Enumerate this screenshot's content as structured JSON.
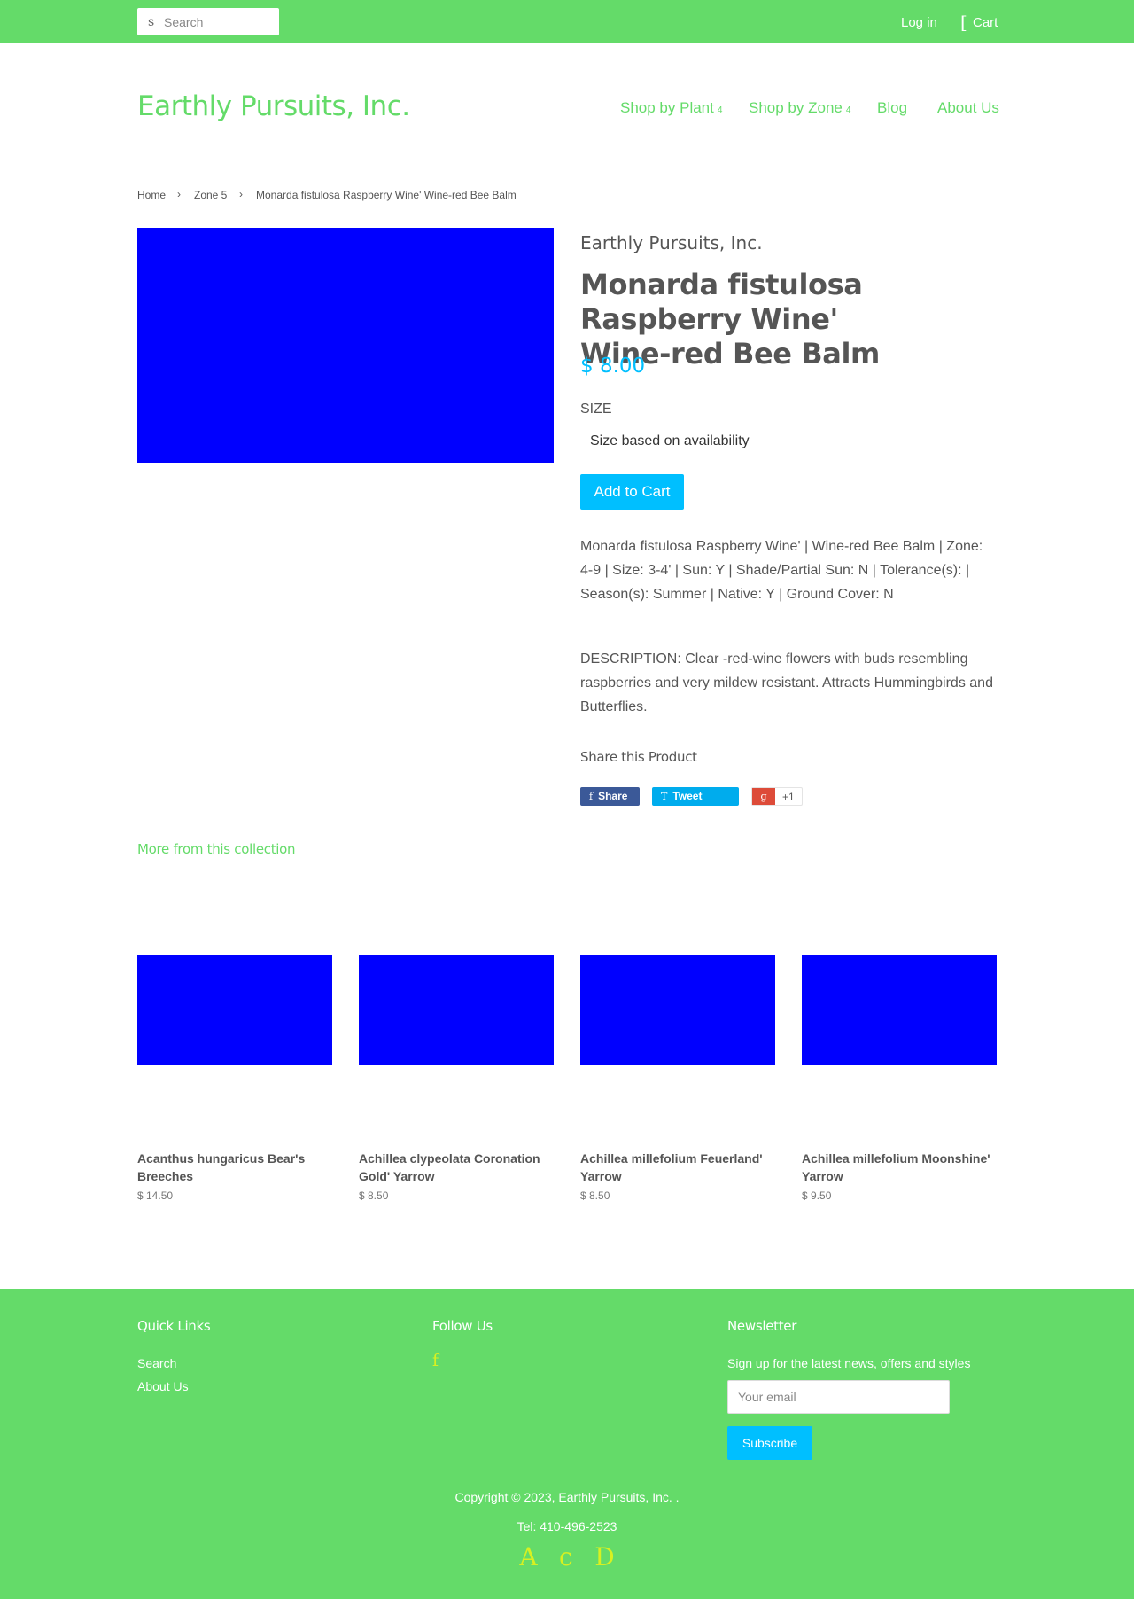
{
  "topbar": {
    "search_icon": "s",
    "search_placeholder": "Search",
    "login_label": "Log in",
    "cart_icon": "[",
    "cart_label": "Cart"
  },
  "header": {
    "site_title": "Earthly Pursuits, Inc.",
    "nav": [
      {
        "label": "Shop by Plant",
        "caret": "4"
      },
      {
        "label": "Shop by Zone",
        "caret": "4"
      },
      {
        "label": "Blog"
      },
      {
        "label": "About Us"
      }
    ]
  },
  "breadcrumb": {
    "items": [
      "Home",
      "Zone 5",
      "Monarda fistulosa Raspberry Wine' Wine-red Bee Balm"
    ],
    "separator": "›"
  },
  "product": {
    "vendor": "Earthly Pursuits, Inc.",
    "title_line1": "Monarda fistulosa Raspberry Wine'",
    "title_line2": "Wine-red Bee Balm",
    "price": "$ 8.00",
    "size_label": "SIZE",
    "size_selected": "Size based on availability",
    "add_to_cart": "Add to Cart",
    "details": "Monarda fistulosa Raspberry Wine' | Wine-red Bee Balm | Zone: 4-9 | Size: 3-4' | Sun: Y | Shade/Partial Sun: N | Tolerance(s): | Season(s): Summer | Native: Y | Ground Cover: N",
    "description": "DESCRIPTION: Clear -red-wine flowers with buds resembling raspberries and very mildew resistant. Attracts Hummingbirds and Butterflies.",
    "image_color": "#0000ff"
  },
  "share": {
    "title": "Share this Product",
    "facebook": {
      "icon": "f",
      "label": "Share"
    },
    "twitter": {
      "icon": "T",
      "label": "Tweet"
    },
    "google": {
      "icon": "g",
      "label": "+1"
    }
  },
  "related": {
    "title": "More from this collection",
    "items": [
      {
        "name": "Acanthus hungaricus Bear's Breeches",
        "price": "$ 14.50"
      },
      {
        "name": "Achillea clypeolata Coronation Gold' Yarrow",
        "price": "$ 8.50"
      },
      {
        "name": "Achillea millefolium Feuerland' Yarrow",
        "price": "$ 8.50"
      },
      {
        "name": "Achillea millefolium Moonshine' Yarrow",
        "price": "$ 9.50"
      }
    ]
  },
  "footer": {
    "quick_links_title": "Quick Links",
    "quick_links": [
      "Search",
      "About Us"
    ],
    "follow_title": "Follow Us",
    "follow_icon": "f",
    "newsletter_title": "Newsletter",
    "newsletter_text": "Sign up for the latest news, offers and styles",
    "email_placeholder": "Your email",
    "subscribe_label": "Subscribe",
    "copyright": "Copyright © 2023, Earthly Pursuits, Inc. .",
    "tel": "Tel: 410-496-2523",
    "payment_icons": [
      "A",
      "c",
      "D"
    ]
  },
  "colors": {
    "brand_green": "#64db69",
    "accent_blue": "#00bfff",
    "icon_yellow": "#d8f021"
  }
}
